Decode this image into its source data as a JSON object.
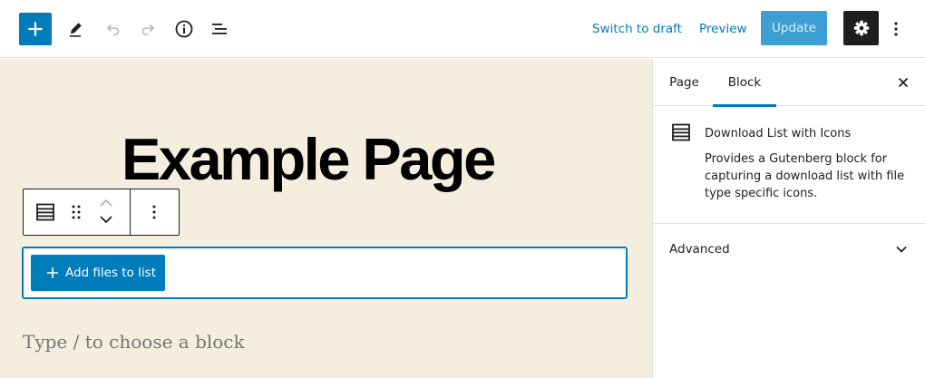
{
  "header": {
    "inserter_icon": "plus-icon",
    "tools": [
      {
        "name": "edit",
        "icon": "pencil-icon"
      },
      {
        "name": "undo",
        "icon": "undo-icon"
      },
      {
        "name": "redo",
        "icon": "redo-icon"
      },
      {
        "name": "details",
        "icon": "info-icon"
      },
      {
        "name": "list-view",
        "icon": "list-view-icon"
      }
    ],
    "switch_to_draft_label": "Switch to draft",
    "preview_label": "Preview",
    "update_label": "Update",
    "settings_icon": "gear-icon",
    "more_icon": "vertical-ellipsis-icon"
  },
  "editor": {
    "page_title": "Example Page",
    "block_toolbar": {
      "block_icon": "download-list-icon",
      "drag_icon": "drag-handle-icon",
      "move_up_icon": "chevron-up-icon",
      "move_down_icon": "chevron-down-icon",
      "options_icon": "vertical-ellipsis-icon"
    },
    "add_files_label": "Add files to list",
    "appender_placeholder": "Type / to choose a block"
  },
  "sidebar": {
    "tabs": [
      {
        "label": "Page",
        "active": false
      },
      {
        "label": "Block",
        "active": true
      }
    ],
    "close_icon": "close-icon",
    "block_card": {
      "icon": "download-list-icon",
      "title": "Download List with Icons",
      "description": "Provides a Gutenberg block for capturing a download list with file type specific icons."
    },
    "panels": [
      {
        "label": "Advanced",
        "expanded": false
      }
    ]
  },
  "colors": {
    "accent": "#007cba",
    "update_button": "#3e9fd4",
    "canvas_background": "#f5eedf",
    "dark": "#1e1e1e",
    "border": "#e0e0e0"
  }
}
